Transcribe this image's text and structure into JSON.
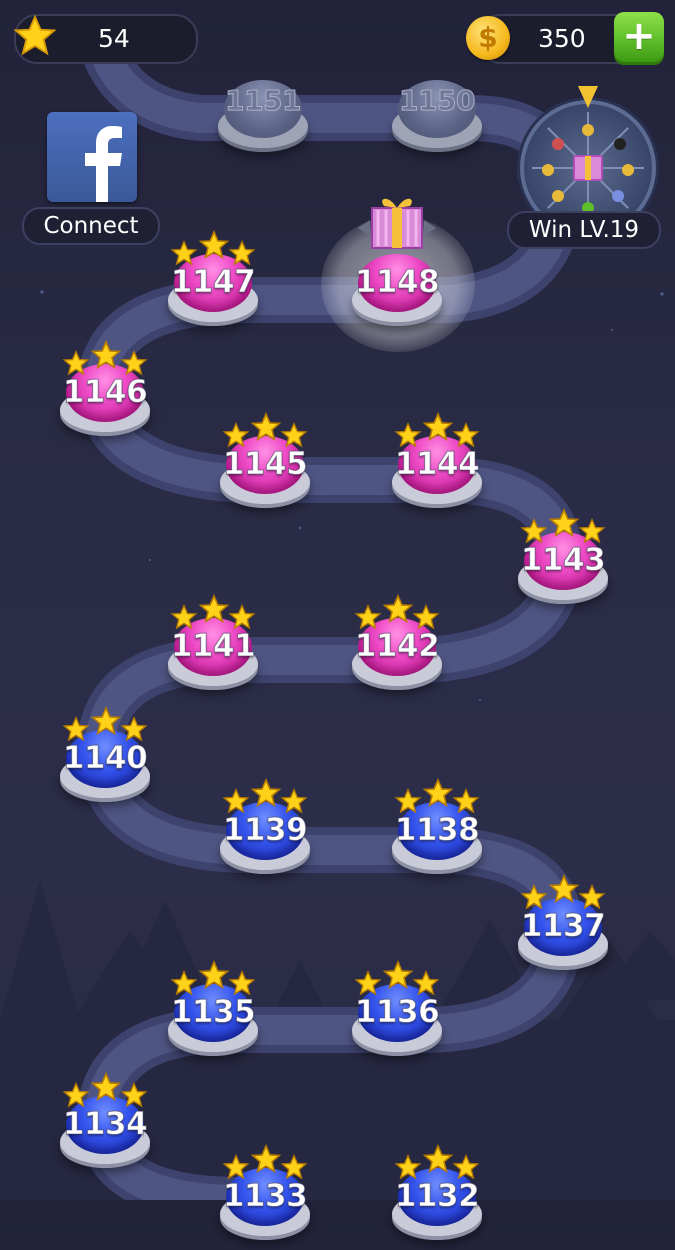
{
  "header": {
    "stars_count": "54",
    "coins_count": "350",
    "add_coins_symbol": "+"
  },
  "facebook": {
    "connect_label": "Connect"
  },
  "lucky_wheel": {
    "label": "Win LV.19"
  },
  "levels": [
    {
      "number": "1151",
      "state": "locked",
      "stars": 0
    },
    {
      "number": "1150",
      "state": "locked",
      "stars": 0
    },
    {
      "number": "1148",
      "state": "current",
      "color": "pink",
      "stars": 0,
      "reward": "gift"
    },
    {
      "number": "1147",
      "state": "complete",
      "color": "pink",
      "stars": 3
    },
    {
      "number": "1146",
      "state": "complete",
      "color": "pink",
      "stars": 3
    },
    {
      "number": "1145",
      "state": "complete",
      "color": "pink",
      "stars": 3
    },
    {
      "number": "1144",
      "state": "complete",
      "color": "pink",
      "stars": 3
    },
    {
      "number": "1143",
      "state": "complete",
      "color": "pink",
      "stars": 3
    },
    {
      "number": "1142",
      "state": "complete",
      "color": "pink",
      "stars": 3
    },
    {
      "number": "1141",
      "state": "complete",
      "color": "pink",
      "stars": 3
    },
    {
      "number": "1140",
      "state": "complete",
      "color": "blue",
      "stars": 3
    },
    {
      "number": "1139",
      "state": "complete",
      "color": "blue",
      "stars": 3
    },
    {
      "number": "1138",
      "state": "complete",
      "color": "blue",
      "stars": 3
    },
    {
      "number": "1137",
      "state": "complete",
      "color": "blue",
      "stars": 3
    },
    {
      "number": "1136",
      "state": "complete",
      "color": "blue",
      "stars": 3
    },
    {
      "number": "1135",
      "state": "complete",
      "color": "blue",
      "stars": 3
    },
    {
      "number": "1134",
      "state": "complete",
      "color": "blue",
      "stars": 3
    },
    {
      "number": "1133",
      "state": "complete",
      "color": "blue",
      "stars": 3
    },
    {
      "number": "1132",
      "state": "complete",
      "color": "blue",
      "stars": 3
    }
  ],
  "colors": {
    "background": "#2a2b45",
    "path": "#4a5079",
    "pink_button": "#e23fbe",
    "blue_button": "#2a44d8",
    "star": "#ffd21a",
    "coin": "#f5b81c",
    "add_button": "#5fbf2a",
    "facebook": "#3b5998"
  }
}
